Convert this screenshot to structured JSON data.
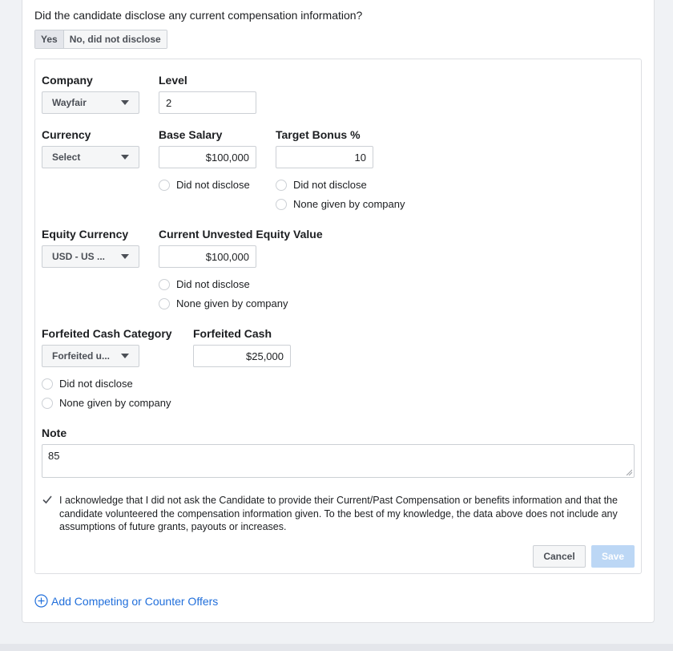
{
  "question": "Did the candidate disclose any current compensation information?",
  "disclose_toggle": {
    "yes": "Yes",
    "no": "No, did not disclose"
  },
  "fields": {
    "company": {
      "label": "Company",
      "value": "Wayfair"
    },
    "level": {
      "label": "Level",
      "value": "2"
    },
    "currency": {
      "label": "Currency",
      "value": "Select"
    },
    "base_salary": {
      "label": "Base Salary",
      "value": "$100,000"
    },
    "target_bonus": {
      "label": "Target Bonus %",
      "value": "10"
    },
    "equity_currency": {
      "label": "Equity Currency",
      "value": "USD - US ..."
    },
    "unvested_equity": {
      "label": "Current Unvested Equity Value",
      "value": "$100,000"
    },
    "forfeited_category": {
      "label": "Forfeited Cash Category",
      "value": "Forfeited u..."
    },
    "forfeited_cash": {
      "label": "Forfeited Cash",
      "value": "$25,000"
    }
  },
  "radio_labels": {
    "did_not_disclose": "Did not disclose",
    "none_given": "None given by company"
  },
  "note": {
    "label": "Note",
    "value": "85"
  },
  "acknowledgement": "I acknowledge that I did not ask the Candidate to provide their Current/Past Compensation or benefits information and that the candidate volunteered the compensation information given. To the best of my knowledge, the data above does not include any assumptions of future grants, payouts or increases.",
  "buttons": {
    "cancel": "Cancel",
    "save": "Save"
  },
  "add_offer": "Add Competing or Counter Offers"
}
